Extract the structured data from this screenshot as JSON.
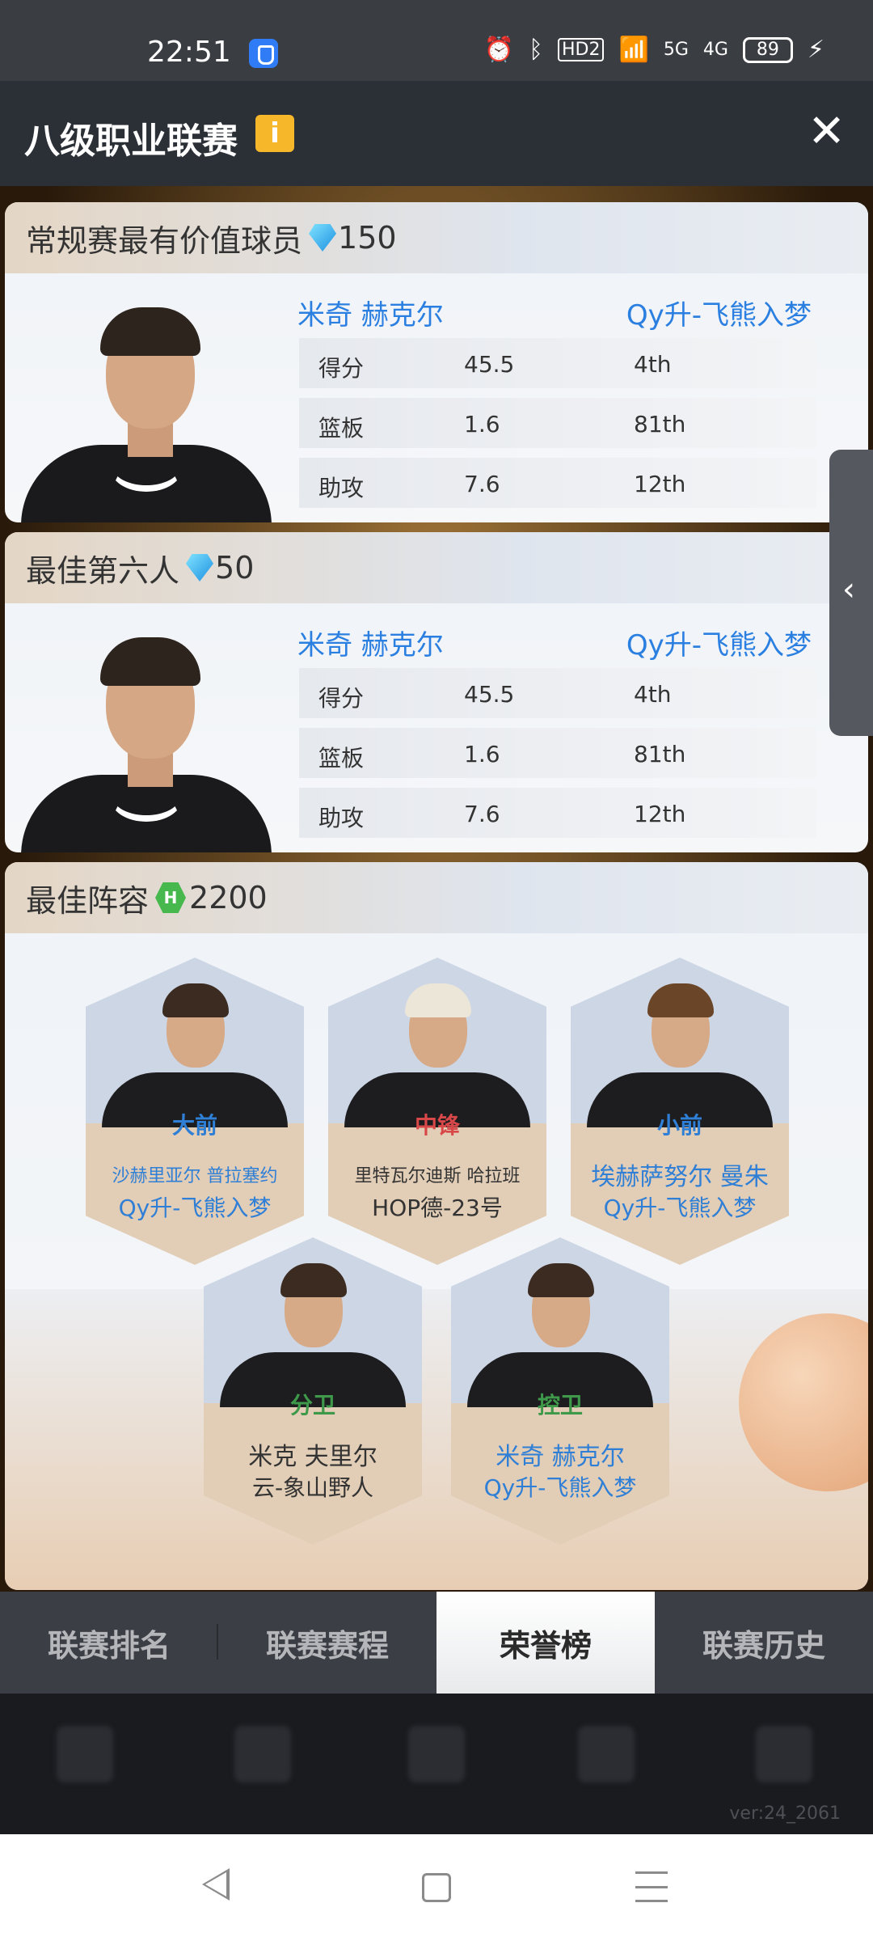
{
  "status_bar": {
    "time": "22:51",
    "battery": "89",
    "network_labels": [
      "HD2",
      "5G",
      "4G"
    ]
  },
  "header": {
    "title": "八级职业联赛"
  },
  "cards": [
    {
      "title": "常规赛最有价值球员",
      "reward": "150",
      "player": "米奇 赫克尔",
      "team": "Qy升-飞熊入梦",
      "stats": [
        {
          "label": "得分",
          "value": "45.5",
          "rank": "4th"
        },
        {
          "label": "篮板",
          "value": "1.6",
          "rank": "81th"
        },
        {
          "label": "助攻",
          "value": "7.6",
          "rank": "12th"
        }
      ]
    },
    {
      "title": "最佳第六人",
      "reward": "50",
      "player": "米奇 赫克尔",
      "team": "Qy升-飞熊入梦",
      "stats": [
        {
          "label": "得分",
          "value": "45.5",
          "rank": "4th"
        },
        {
          "label": "篮板",
          "value": "1.6",
          "rank": "81th"
        },
        {
          "label": "助攻",
          "value": "7.6",
          "rank": "12th"
        }
      ]
    }
  ],
  "lineup": {
    "title": "最佳阵容",
    "reward": "2200",
    "coin_letter": "H",
    "players": [
      {
        "position": "大前",
        "name": "沙赫里亚尔 普拉塞约",
        "team": "Qy升-飞熊入梦"
      },
      {
        "position": "中锋",
        "name": "里特瓦尔迪斯 哈拉班",
        "team": "HOP德-23号"
      },
      {
        "position": "小前",
        "name": "埃赫萨努尔 曼朱",
        "team": "Qy升-飞熊入梦"
      },
      {
        "position": "分卫",
        "name": "米克 夫里尔",
        "team": "云-象山野人"
      },
      {
        "position": "控卫",
        "name": "米奇 赫克尔",
        "team": "Qy升-飞熊入梦"
      }
    ]
  },
  "tabs": [
    "联赛排名",
    "联赛赛程",
    "荣誉榜",
    "联赛历史"
  ],
  "active_tab": "荣誉榜",
  "version": "ver:24_2061",
  "colors": {
    "accent_blue": "#2a7fe0",
    "position_blue": "#2f7fd6",
    "position_red": "#d84848",
    "position_green": "#3e9a4a"
  },
  "icons": {
    "reward_gem": "diamond-icon",
    "reward_coin": "hex-coin-icon",
    "info": "info-icon",
    "close": "close-icon"
  }
}
